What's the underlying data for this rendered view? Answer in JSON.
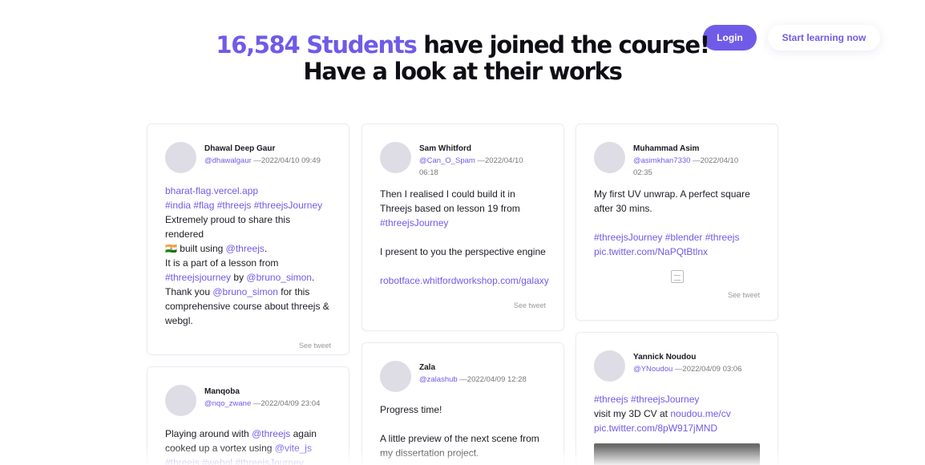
{
  "nav": {
    "login": "Login",
    "start": "Start learning now"
  },
  "hero": {
    "count": "16,584 Students",
    "line1_rest": " have joined the course!",
    "line2": "Have a look at their works"
  },
  "tweets": [
    {
      "name": "Dhawal Deep Gaur",
      "handle": "@dhawalgaur",
      "date": " —2022/04/10 09:49",
      "l1": "bharat-flag.vercel.app",
      "l2": "#india #flag #threejs #threejsJourney",
      "l3": "Extremely proud to share this rendered",
      "l4a": "🇮🇳 built using ",
      "l4b": "@threejs",
      "l4c": ".",
      "l5": "It is a part of a lesson from",
      "l6a": "#threejsjourney",
      "l6b": " by ",
      "l6c": "@bruno_simon",
      "l6d": ".",
      "l7a": "Thank you ",
      "l7b": "@bruno_simon",
      "l7c": " for this",
      "l8": "comprehensive course about threejs &",
      "l9": "webgl.",
      "see": "See tweet"
    },
    {
      "name": "Sam Whitford",
      "handle": "@Can_O_Spam",
      "date": " —2022/04/10",
      "date2": "06:18",
      "l1": "Then I realised I could build it in",
      "l2": "Threejs based on lesson 19 from",
      "l3": "#threejsJourney",
      "l4": "I present to you the perspective engine",
      "l5": "robotface.whitfordworkshop.com/galaxy",
      "see": "See tweet"
    },
    {
      "name": "Muhammad Asim",
      "handle": "@asimkhan7330",
      "date": " —2022/04/10",
      "date2": "02:35",
      "l1": "My first UV unwrap. A perfect square",
      "l2": "after 30 mins.",
      "l3": "#threejsJourney #blender #threejs",
      "l4": "pic.twitter.com/NaPQtBtlnx",
      "see": "See tweet"
    },
    {
      "name": "Manqoba",
      "handle": "@nqo_zwane",
      "date": " —2022/04/09 23:04",
      "l1a": "Playing around with ",
      "l1b": "@threejs",
      "l1c": " again",
      "l2a": "cooked up a vortex using ",
      "l2b": "@vite_js",
      "l3": "#threejs #webgl #threejsJourney"
    },
    {
      "name": "Zala",
      "handle": "@zalashub",
      "date": " —2022/04/09 12:28",
      "l1": "Progress time!",
      "l2": "A little preview of the next scene from",
      "l3": "my dissertation project."
    },
    {
      "name": "Yannick Noudou",
      "handle": "@YNoudou",
      "date": " —2022/04/09 03:06",
      "l1": "#threejs #threejsJourney",
      "l2a": "visit my 3D CV at ",
      "l2b": "noudou.me/cv",
      "l3": "pic.twitter.com/8pW917jMND"
    }
  ]
}
